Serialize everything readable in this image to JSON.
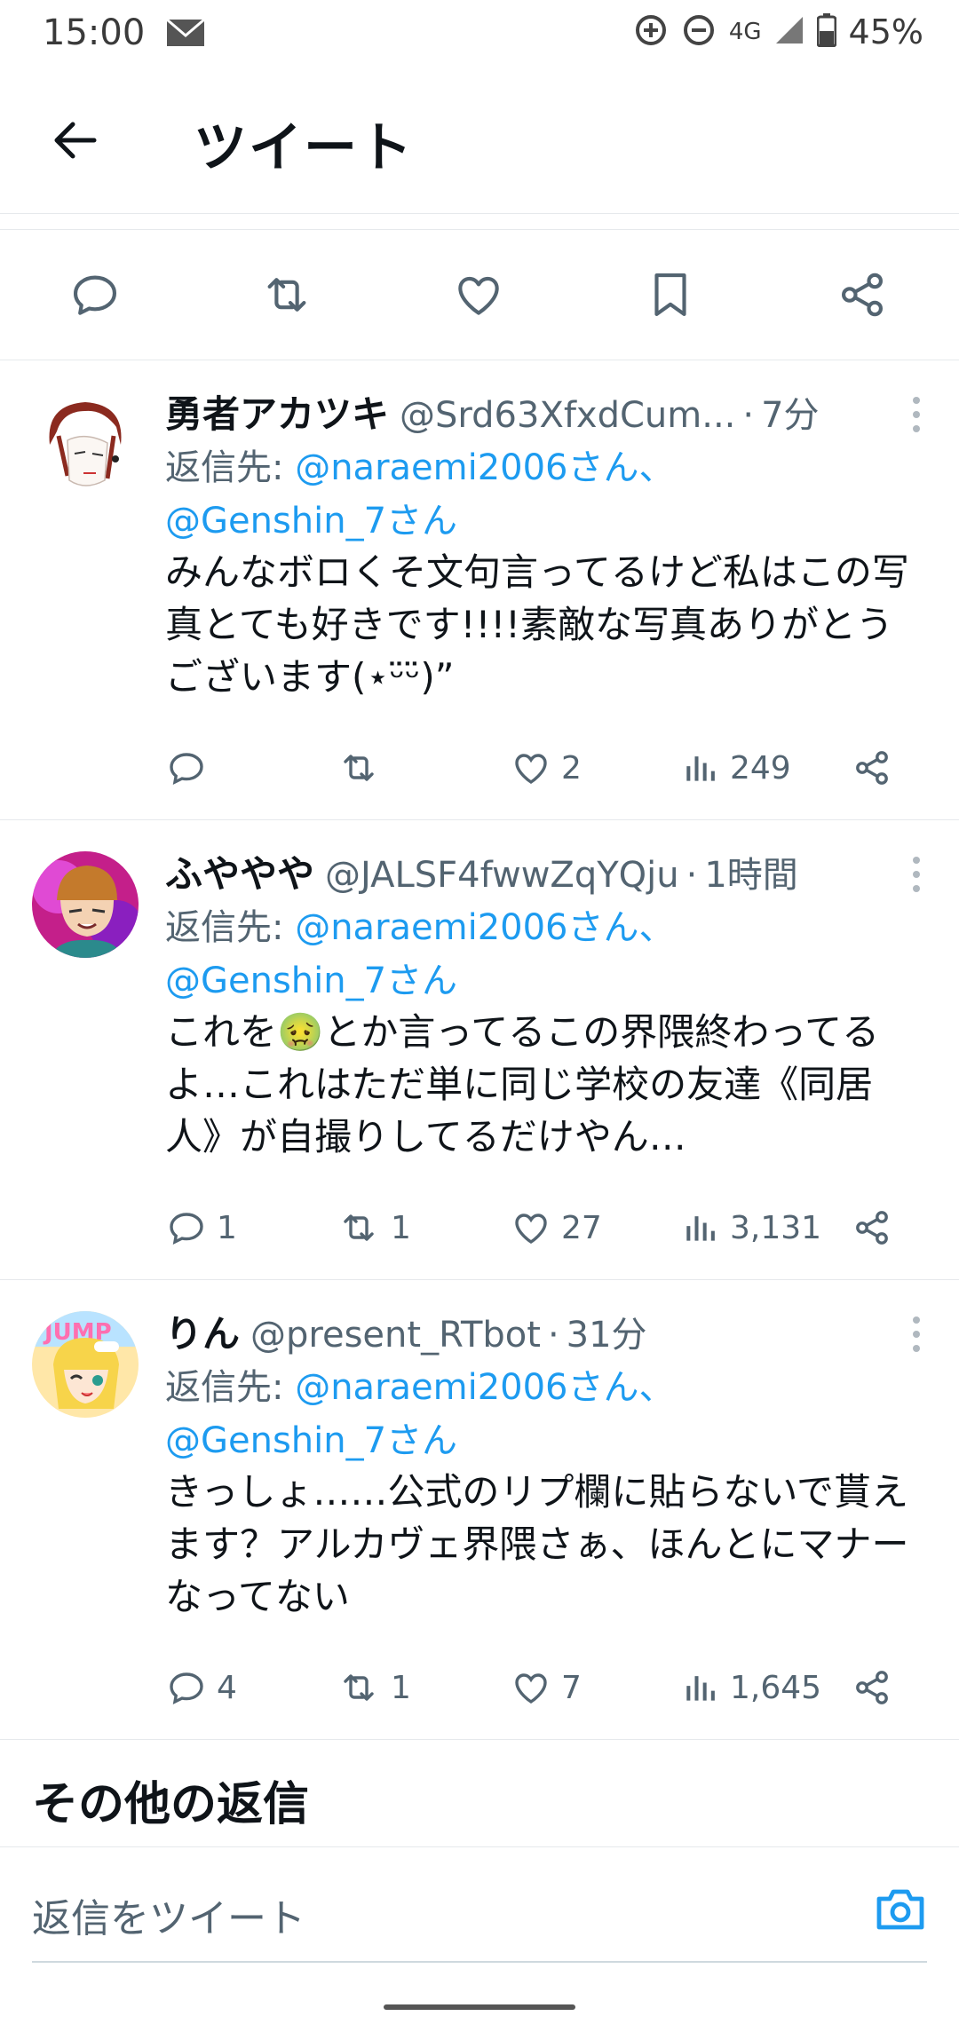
{
  "status_bar": {
    "time": "15:00",
    "network": "4G",
    "battery": "45%"
  },
  "header": {
    "title": "ツイート"
  },
  "tweets": [
    {
      "name": "勇者アカツキ",
      "handle": "@Srd63XfxdCum...",
      "time": "7分",
      "reply_prefix": "返信先: ",
      "reply_to_1": "@naraemi2006さん、",
      "reply_to_2": "@Genshin_7さん",
      "body": "みんなボロくそ文句言ってるけど私はこの写真とても好きです!!!!素敵な写真ありがとうございます(⋆ᵕ̈ᵕ̈)”",
      "replies": "",
      "retweets": "",
      "likes": "2",
      "views": "249"
    },
    {
      "name": "ふややや",
      "handle": "@JALSF4fwwZqYQju",
      "time": "1時間",
      "reply_prefix": "返信先: ",
      "reply_to_1": "@naraemi2006さん、",
      "reply_to_2": "@Genshin_7さん",
      "body": "これを🤢とか言ってるこの界隈終わってるよ…これはただ単に同じ学校の友達《同居人》が自撮りしてるだけやん…",
      "replies": "1",
      "retweets": "1",
      "likes": "27",
      "views": "3,131"
    },
    {
      "name": "りん",
      "handle": "@present_RTbot",
      "time": "31分",
      "reply_prefix": "返信先: ",
      "reply_to_1": "@naraemi2006さん、",
      "reply_to_2": "@Genshin_7さん",
      "body": "きっしょ……公式のリプ欄に貼らないで貰えます？アルカヴェ界隈さぁ、ほんとにマナーなってない",
      "replies": "4",
      "retweets": "1",
      "likes": "7",
      "views": "1,645"
    }
  ],
  "more_replies": "その他の返信",
  "composer": {
    "placeholder": "返信をツイート"
  },
  "colors": {
    "accent": "#1d9bf0",
    "text": "#0f1419",
    "secondary": "#536471"
  }
}
